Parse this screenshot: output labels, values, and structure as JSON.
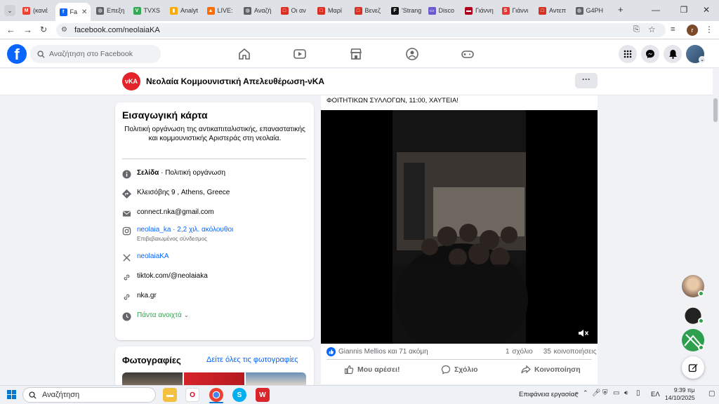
{
  "browser": {
    "tabs": [
      {
        "label": "(κανέ",
        "color": "#ea4335",
        "glyph": "M"
      },
      {
        "label": "Fa",
        "color": "#0866ff",
        "glyph": "f",
        "active": true
      },
      {
        "label": "Επεξη",
        "color": "#5f6368",
        "glyph": "◍"
      },
      {
        "label": "TVXS",
        "color": "#34a853",
        "glyph": "V"
      },
      {
        "label": "Analyt",
        "color": "#f9ab00",
        "glyph": "▮"
      },
      {
        "label": "LIVE: ",
        "color": "#ff6d00",
        "glyph": "▲"
      },
      {
        "label": "Αναζή",
        "color": "#5f6368",
        "glyph": "◍"
      },
      {
        "label": "Οι αν",
        "color": "#d93025",
        "glyph": "□"
      },
      {
        "label": "Μαρί",
        "color": "#d93025",
        "glyph": "□"
      },
      {
        "label": "Βενεζ",
        "color": "#d93025",
        "glyph": "□"
      },
      {
        "label": "'Strang",
        "color": "#111111",
        "glyph": "F"
      },
      {
        "label": "Disco",
        "color": "#6a5acd",
        "glyph": "▭"
      },
      {
        "label": "Γιάννη",
        "color": "#b00020",
        "glyph": "▬"
      },
      {
        "label": "Γιάννι",
        "color": "#e53935",
        "glyph": "S"
      },
      {
        "label": "Αντεπ",
        "color": "#d93025",
        "glyph": "□"
      },
      {
        "label": "G4PH",
        "color": "#5f6368",
        "glyph": "◍"
      }
    ],
    "new_tab": "+",
    "url": "facebook.com/neolaiaKA",
    "profile_initial": "r"
  },
  "fb": {
    "logo": "f",
    "search_placeholder": "Αναζήτηση στο Facebook"
  },
  "page": {
    "logo_text": "νKA",
    "name": "Νεολαία Κομμουνιστική Απελευθέρωση-νΚΑ",
    "more": "···"
  },
  "intro": {
    "title": "Εισαγωγική κάρτα",
    "bio": "Πολιτική οργάνωση της αντικαπιταλιστικής, επαναστατικής και κομμουνιστικής Αριστεράς στη νεολαία.",
    "category_bold": "Σελίδα",
    "category_rest": " · Πολιτική οργάνωση",
    "address": "Κλεισόβης 9 , Athens, Greece",
    "email": "connect.nka@gmail.com",
    "instagram": "neolaia_ka · 2,2 χιλ. ακόλουθοι",
    "instagram_sub": "Επιβεβαιωμένος σύνδεσμος",
    "x_handle": "neolaiaKA",
    "tiktok": "tiktok.com/@neolaiaka",
    "website": "nka.gr",
    "hours": "Πάντα ανοιχτά"
  },
  "photos": {
    "title": "Φωτογραφίες",
    "see_all": "Δείτε όλες τις φωτογραφίες"
  },
  "post": {
    "text": "ΦΟΙΤΗΤΙΚΩΝ ΣΥΛΛΟΓΩΝ, 11:00, ΧΑΥΤΕΙΑ!",
    "reactions": "Giannis Mellios και 71 ακόμη",
    "comments": "1 σχόλιο",
    "shares": "35 κοινοποιήσεις",
    "like": "Μου αρέσει!",
    "comment": "Σχόλιο",
    "share": "Κοινοποίηση"
  },
  "taskbar": {
    "search": "Αναζήτηση",
    "desktop": "Επιφάνεια εργασίας",
    "lang": "ΕΛ",
    "time": "9:39 πμ",
    "date": "14/10/2025"
  },
  "colors": {
    "fb_blue": "#0866ff",
    "page_red": "#e2232a",
    "online_green": "#31a24c"
  }
}
